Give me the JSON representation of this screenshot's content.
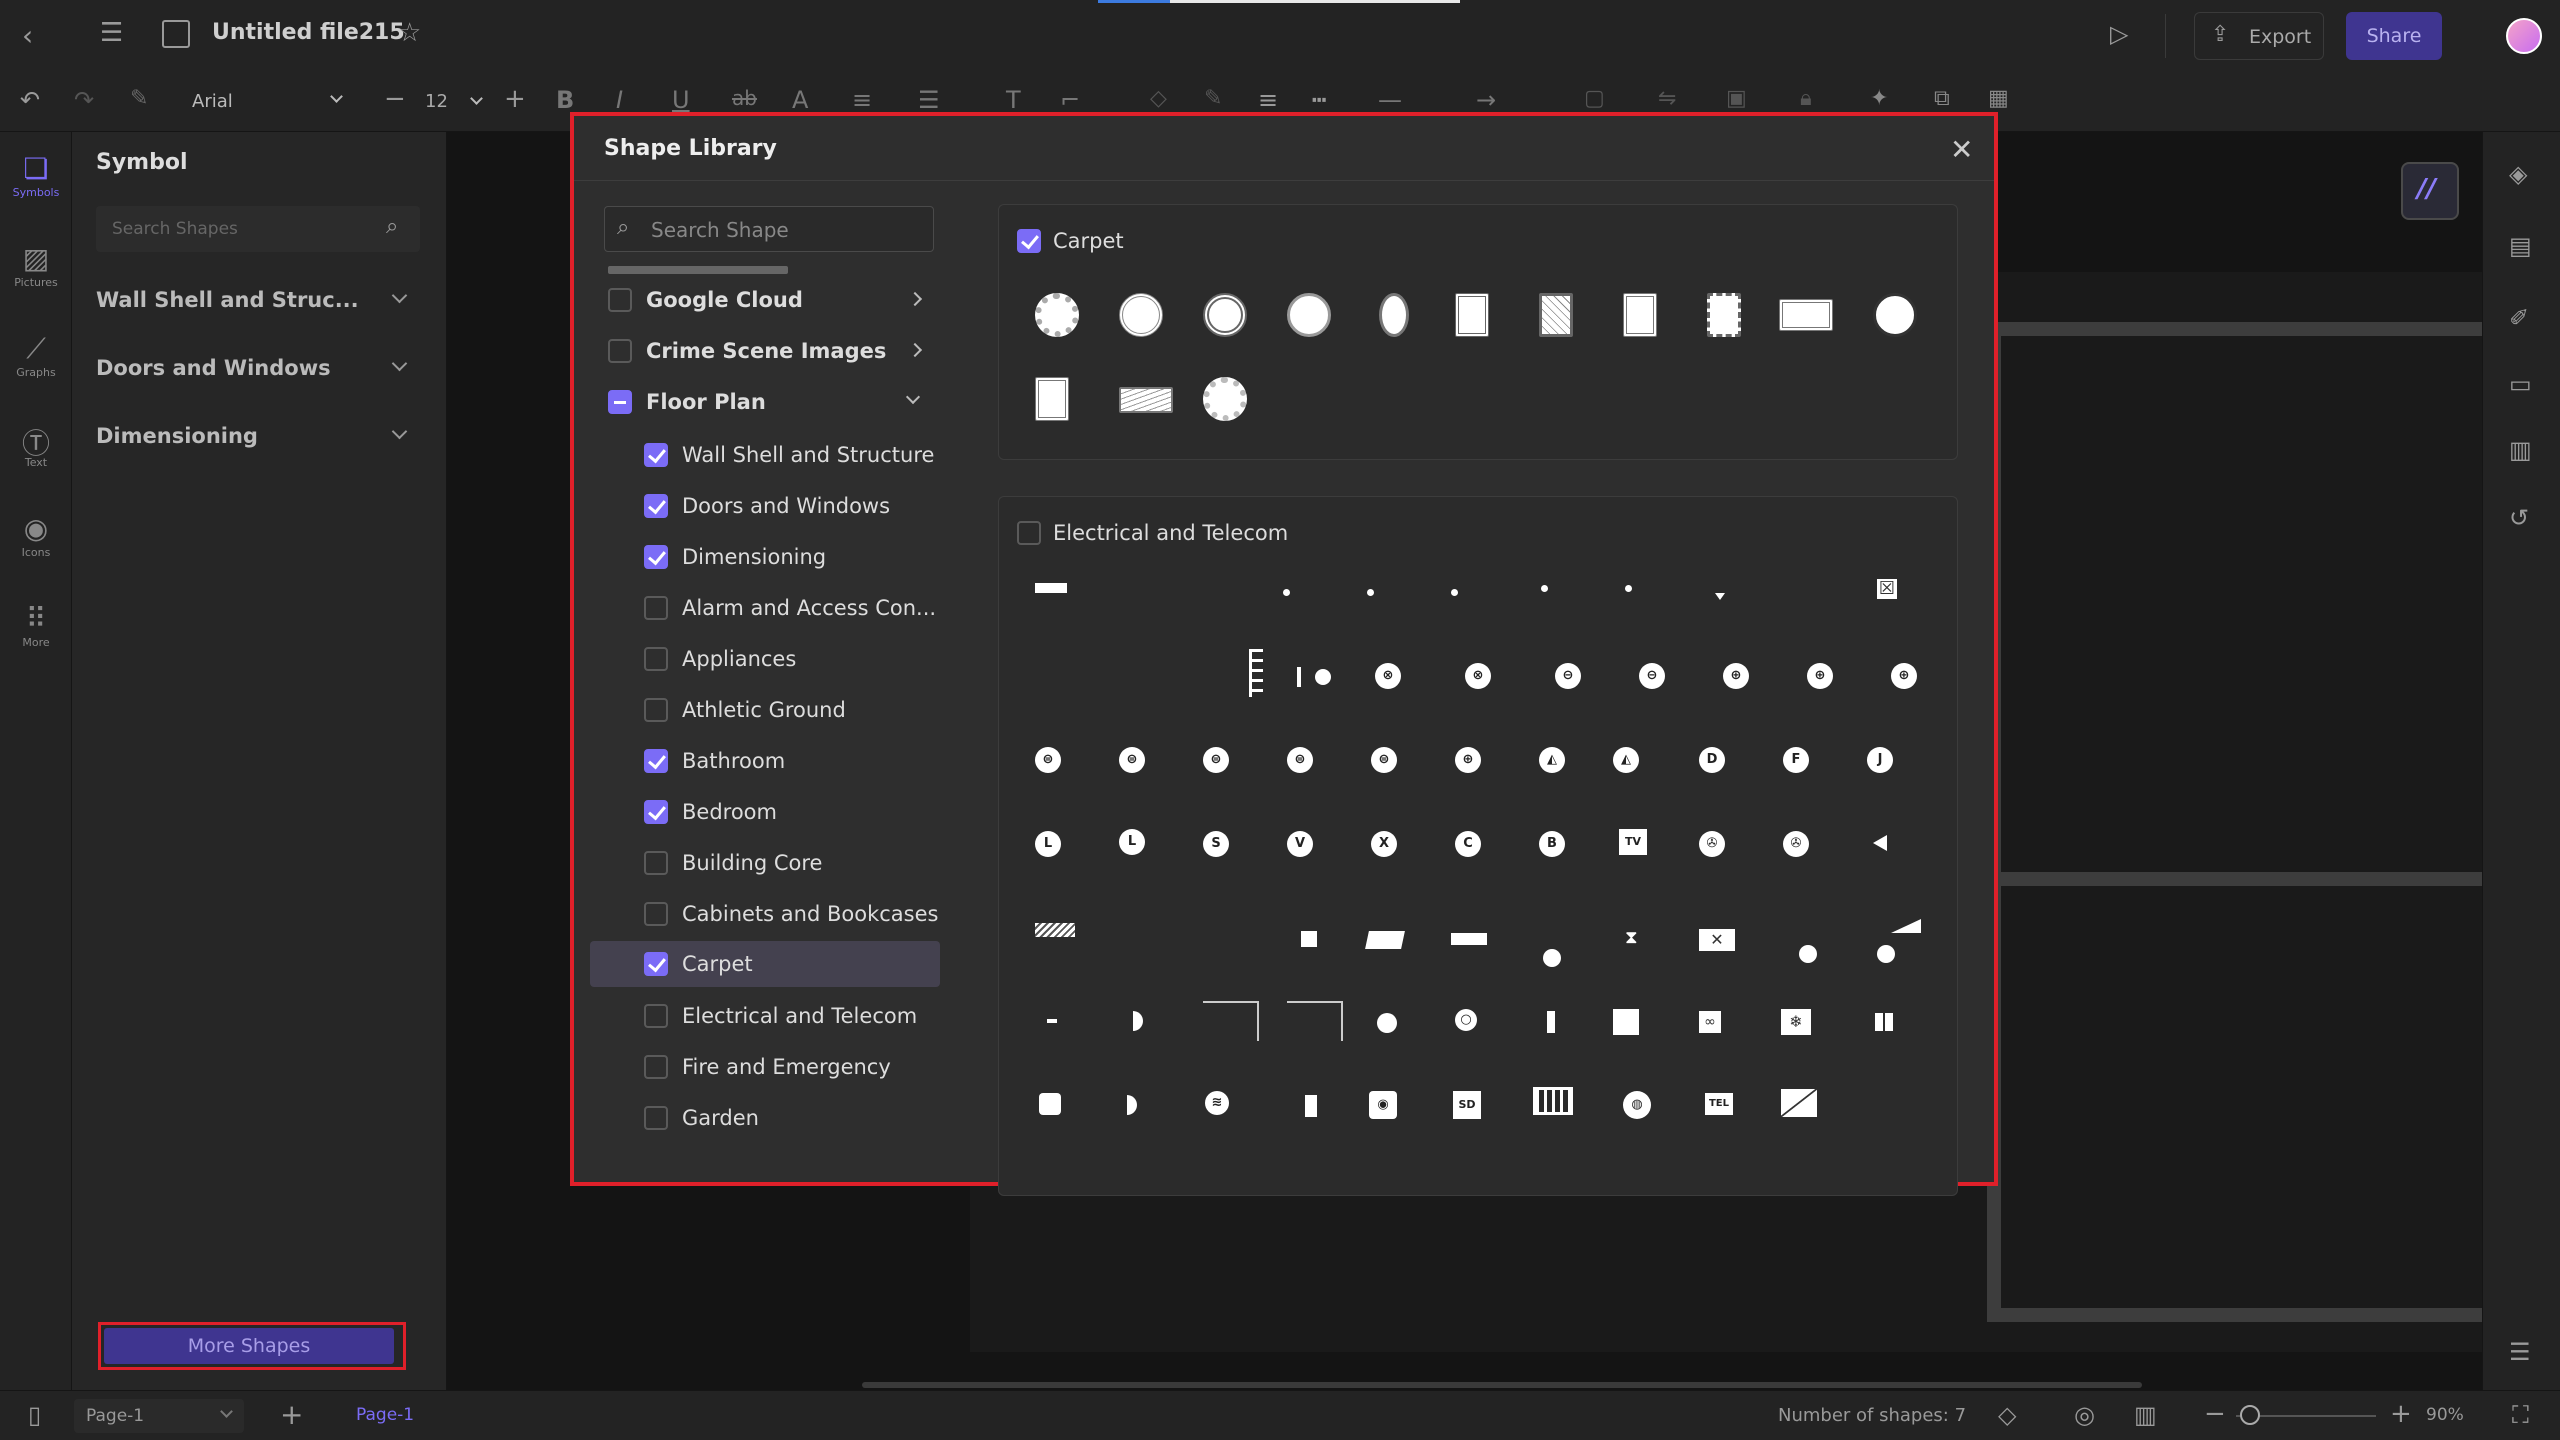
{
  "app": {
    "file_title": "Untitled file215",
    "export_label": "Export",
    "share_label": "Share"
  },
  "toolbar": {
    "font_name": "Arial",
    "font_size": "12"
  },
  "left_rail": {
    "items": [
      {
        "label": "Symbols",
        "icon": "symbols-icon"
      },
      {
        "label": "Pictures",
        "icon": "pictures-icon"
      },
      {
        "label": "Graphs",
        "icon": "graphs-icon"
      },
      {
        "label": "Text",
        "icon": "text-icon"
      },
      {
        "label": "Icons",
        "icon": "icons-icon"
      },
      {
        "label": "More",
        "icon": "more-icon"
      }
    ]
  },
  "side_panel": {
    "title": "Symbol",
    "search_placeholder": "Search Shapes",
    "sections": [
      {
        "label": "Wall Shell and Struc..."
      },
      {
        "label": "Doors and Windows"
      },
      {
        "label": "Dimensioning"
      }
    ],
    "more_shapes_label": "More Shapes"
  },
  "dialog": {
    "title": "Shape Library",
    "search_placeholder": "Search Shape",
    "categories": [
      {
        "label": "Google Cloud",
        "state": "off"
      },
      {
        "label": "Crime Scene Images",
        "state": "off"
      },
      {
        "label": "Floor Plan",
        "state": "partial"
      }
    ],
    "sub_items": [
      {
        "label": "Wall Shell and Structure",
        "checked": true
      },
      {
        "label": "Doors and Windows",
        "checked": true
      },
      {
        "label": "Dimensioning",
        "checked": true
      },
      {
        "label": "Alarm and Access Con...",
        "checked": false
      },
      {
        "label": "Appliances",
        "checked": false
      },
      {
        "label": "Athletic Ground",
        "checked": false
      },
      {
        "label": "Bathroom",
        "checked": true
      },
      {
        "label": "Bedroom",
        "checked": true
      },
      {
        "label": "Building Core",
        "checked": false
      },
      {
        "label": "Cabinets and Bookcases",
        "checked": false
      },
      {
        "label": "Carpet",
        "checked": true,
        "selected": true
      },
      {
        "label": "Electrical and Telecom",
        "checked": false
      },
      {
        "label": "Fire and Emergency",
        "checked": false
      },
      {
        "label": "Garden",
        "checked": false
      }
    ],
    "carpet_group": {
      "label": "Carpet",
      "checked": true
    },
    "electrical_group": {
      "label": "Electrical and Telecom",
      "checked": false
    },
    "electrical_glyphs": {
      "r4": [
        "L",
        "L",
        "S",
        "V",
        "X",
        "C",
        "B",
        "TV"
      ],
      "r7": [
        "SD",
        "TEL"
      ]
    }
  },
  "status": {
    "page_select": "Page-1",
    "page_tab": "Page-1",
    "shape_count": "Number of shapes: 7",
    "zoom": "90%"
  },
  "colors": {
    "accent": "#7b6cf6",
    "highlight_border": "#e0202a",
    "share_bg": "#3f3590"
  }
}
